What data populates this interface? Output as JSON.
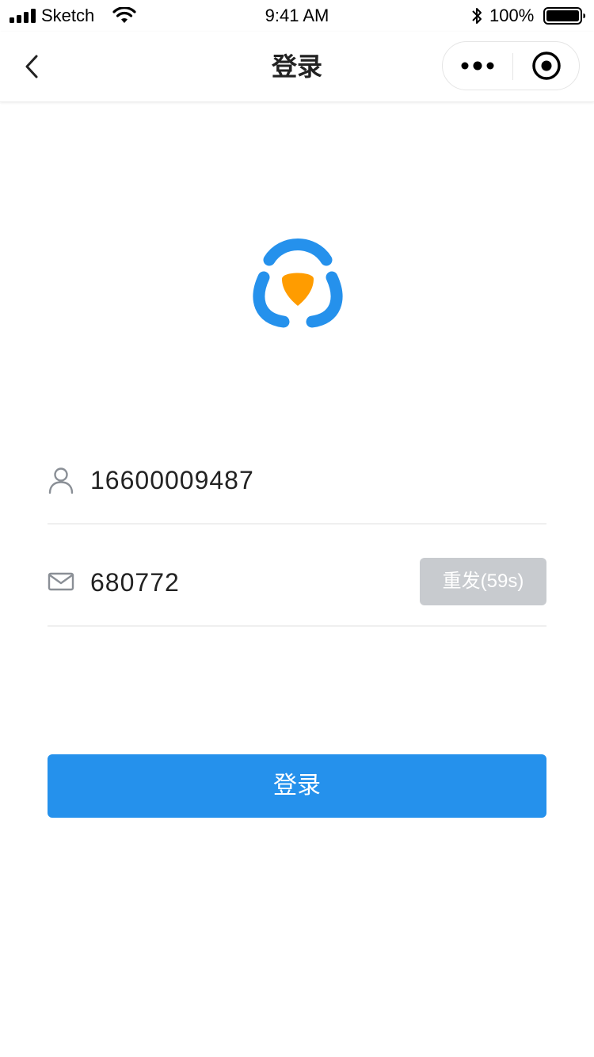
{
  "status_bar": {
    "carrier": "Sketch",
    "time": "9:41 AM",
    "battery_percent": "100%",
    "signal_icon": "signal-bars-icon",
    "wifi_icon": "wifi-icon",
    "bluetooth_icon": "bluetooth-icon",
    "battery_icon": "battery-icon"
  },
  "nav": {
    "title": "登录",
    "back_icon": "chevron-left-icon",
    "more_icon": "more-dots-icon",
    "close_icon": "target-circle-icon"
  },
  "logo": {
    "icon": "app-logo-icon",
    "colors": {
      "ring": "#2591ec",
      "shield": "#ff9c00"
    }
  },
  "form": {
    "phone": {
      "icon": "user-icon",
      "value": "16600009487"
    },
    "code": {
      "icon": "mail-icon",
      "value": "680772",
      "resend_label": "重发(59s)"
    }
  },
  "login_button": {
    "label": "登录"
  },
  "colors": {
    "primary": "#2591ec",
    "disabled": "#c8cbcf",
    "divider": "#efefef",
    "icon_gray": "#8a8f96"
  }
}
